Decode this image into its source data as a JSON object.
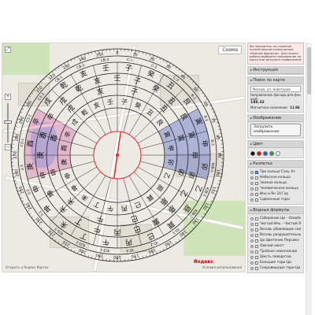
{
  "map": {
    "layers_label": "Схема",
    "zoom_in": "+",
    "zoom_out": "−",
    "footer_left": "Открыть в Яндекс.Картах",
    "footer_right": "Условия использования",
    "logo": "Яндекс",
    "colors": {
      "water": "#a9cfee",
      "park": "#cfe3b8",
      "roads": "#ffffff"
    }
  },
  "compass": {
    "degree_labels": [
      "0",
      "10",
      "20",
      "30",
      "40",
      "50",
      "60",
      "70",
      "80",
      "90",
      "100",
      "110",
      "120",
      "130",
      "140",
      "150",
      "160",
      "170",
      "180",
      "190",
      "200",
      "210",
      "220",
      "230",
      "240",
      "250",
      "260",
      "270",
      "280",
      "290",
      "300",
      "310",
      "320",
      "330",
      "340",
      "350"
    ],
    "chars_ring1": [
      "子",
      "癸",
      "丑",
      "艮",
      "寅",
      "甲",
      "卯",
      "乙",
      "辰",
      "巽",
      "巳",
      "丙",
      "午",
      "丁",
      "未",
      "坤",
      "申",
      "庚",
      "酉",
      "辛",
      "戌",
      "乾",
      "亥",
      "壬"
    ],
    "chars_ring2": [
      "壬",
      "子",
      "癸",
      "丑",
      "艮",
      "寅",
      "甲",
      "卯",
      "乙",
      "辰",
      "巽",
      "巳",
      "丙",
      "午",
      "丁",
      "未",
      "坤",
      "申",
      "庚",
      "酉",
      "辛",
      "戌",
      "乾",
      "亥"
    ],
    "chars_ring3": [
      "子",
      "丑",
      "寅",
      "卯",
      "辰",
      "巳",
      "午",
      "未",
      "申",
      "酉",
      "戌",
      "亥"
    ],
    "gua_labels": [
      "C-1",
      "C-2",
      "C-3",
      "B-1",
      "B-2",
      "B-3",
      "ЮВ-1",
      "ЮВ-2",
      "ЮВ-3",
      "Ю-1",
      "Ю-2",
      "Ю-3",
      "ЮЗ-1",
      "ЮЗ-2",
      "ЮЗ-3",
      "З-1",
      "З-2",
      "З-3",
      "СЗ-1",
      "СЗ-2",
      "СЗ-3",
      "СВ-1",
      "СВ-2",
      "СВ-3"
    ],
    "colors": {
      "ring": "#222222",
      "needle": "#e8262b",
      "sector_blue": "#3d4fc4",
      "sector_pink": "#d45a9e"
    }
  },
  "notice": "Вы находитесь на странице полной версии калькулятора «Водные формулы». Для начала работы выберите направление на карте или загрузите изображение",
  "panel": {
    "instructions": {
      "title": "Инструкция"
    },
    "address": {
      "title": "Поиск по карте",
      "value": "Москва, ул. Новаторов",
      "direction_label": "Направление фасада для фэн шуй:",
      "direction_value": "188.32",
      "magnetic_label": "Магнитное склонение:",
      "magnetic_value": "11.96"
    },
    "image": {
      "title": "Изображение",
      "button": "Загрузить изображение"
    },
    "color": {
      "title": "Цвет",
      "swatches": [
        "#000000",
        "#ff0000",
        "#1a5fd6",
        "#2ea043",
        "#ffffff"
      ]
    },
    "markup": {
      "title": "Разметка",
      "items": [
        {
          "label": "Три кольца Сань Хэ",
          "checked": true
        },
        {
          "label": "Небесное кольцо",
          "checked": false
        },
        {
          "label": "Земное кольцо",
          "checked": false
        },
        {
          "label": "Человеческое кольцо",
          "checked": false
        },
        {
          "label": "Ина и Ян 24 Гор",
          "checked": false
        },
        {
          "label": "Сдвоенные горы",
          "checked": false
        }
      ]
    },
    "formulas": {
      "title": "Водные формулы",
      "items": [
        {
          "label": "Собирание Ци - Освобождение Ци",
          "checked": false
        },
        {
          "label": "Чистый Инь - Чистый Ян",
          "checked": false
        },
        {
          "label": "Весовь убивающих сил",
          "checked": false
        },
        {
          "label": "Весовь разрушительные дороги",
          "checked": false
        },
        {
          "label": "Ци Цветение Персика",
          "checked": false
        },
        {
          "label": "Овечий хвост",
          "checked": false
        },
        {
          "label": "Тройное накопление",
          "checked": false
        },
        {
          "label": "Шесть поворотов",
          "checked": false
        },
        {
          "label": "Большие тори Ци",
          "checked": false
        },
        {
          "label": "Сокровищные тори Ци",
          "checked": false
        }
      ]
    }
  }
}
